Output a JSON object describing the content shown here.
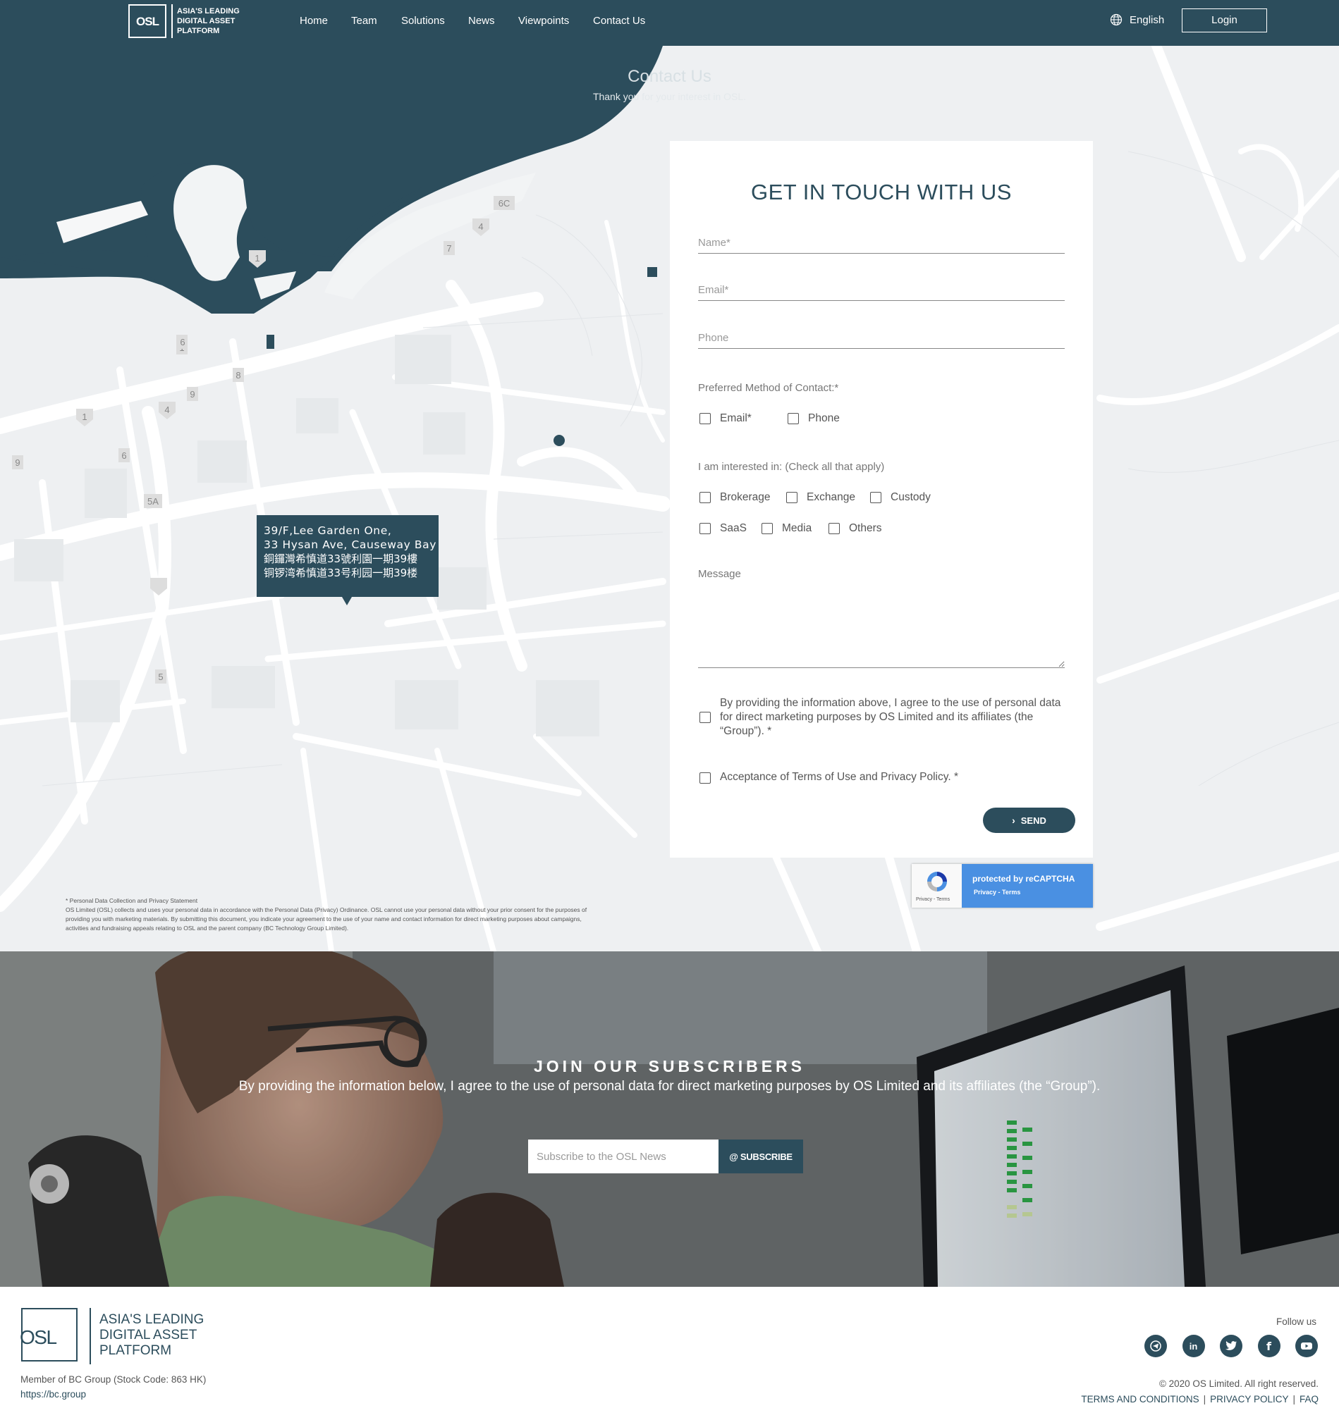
{
  "nav": {
    "logo": "OSL",
    "tagline_1": "ASIA'S LEADING",
    "tagline_2": "DIGITAL ASSET",
    "tagline_3": "PLATFORM",
    "links": [
      "Home",
      "Team",
      "Solutions",
      "News",
      "Viewpoints",
      "Contact Us"
    ],
    "language": "English",
    "login": "Login"
  },
  "hero": {
    "title": "Contact Us",
    "subtitle": "Thank you for your interest in OSL."
  },
  "map": {
    "address_1": "39/F,Lee Garden One,",
    "address_2": "33 Hysan Ave, Causeway Bay",
    "address_3": "銅鑼灣希慎道33號利園一期39樓",
    "address_4": "铜锣湾希慎道33号利园一期39楼",
    "route_labels": [
      "1",
      "6",
      "8",
      "9",
      "1",
      "4",
      "6",
      "5A",
      "9",
      "5",
      "7",
      "4",
      "6C"
    ]
  },
  "form": {
    "title": "GET IN TOUCH WITH US",
    "name_placeholder": "Name*",
    "email_placeholder": "Email*",
    "phone_placeholder": "Phone",
    "method_label": "Preferred Method of Contact:*",
    "method_email": "Email*",
    "method_phone": "Phone",
    "interest_label": "I am interested in: (Check all that apply)",
    "interest_brokerage": "Brokerage",
    "interest_exchange": "Exchange",
    "interest_custody": "Custody",
    "interest_saas": "SaaS",
    "interest_media": "Media",
    "interest_others": "Others",
    "message_placeholder": "Message",
    "consent_text": "By providing the information above, I agree to the use of personal data for direct marketing purposes by OS Limited and its affiliates (the “Group”). *",
    "accept_text": "Acceptance of Terms of Use and Privacy Policy. *",
    "send_label": "SEND"
  },
  "recaptcha": {
    "title": "protected by reCAPTCHA",
    "links": "Privacy - Terms",
    "small_links": "Privacy - Terms"
  },
  "disclaimer": {
    "heading": "* Personal Data Collection and Privacy Statement",
    "body": "OS Limited (OSL) collects and uses your personal data in accordance with the Personal Data (Privacy) Ordinance. OSL cannot use your personal data without your prior consent for the purposes of providing you with marketing materials. By submitting this document, you indicate your agreement to the use of your name and contact information for direct marketing purposes about campaigns, activities and fundraising appeals relating to OSL and the parent company (BC Technology Group Limited)."
  },
  "subscribe": {
    "title": "JOIN OUR SUBSCRIBERS",
    "text": "By providing the information below, I agree to the use of personal data for direct marketing purposes by OS Limited and its affiliates (the “Group”).",
    "input_placeholder": "Subscribe to the OSL News",
    "button": "@ SUBSCRIBE"
  },
  "footer": {
    "logo": "OSL",
    "tagline_1": "ASIA'S LEADING",
    "tagline_2": "DIGITAL ASSET",
    "tagline_3": "PLATFORM",
    "member": "Member of BC Group (Stock Code: 863 HK)",
    "url": "https://bc.group",
    "follow": "Follow us",
    "socials": [
      "telegram-icon",
      "linkedin-icon",
      "twitter-icon",
      "facebook-icon",
      "youtube-icon"
    ],
    "copyright": "© 2020 OS Limited. All right reserved.",
    "terms": "TERMS AND CONDITIONS",
    "privacy": "PRIVACY POLICY",
    "faq": "FAQ"
  },
  "colors": {
    "brand": "#2c4d5c",
    "map_land": "#eef0f2",
    "recaptcha_blue": "#4a90e2"
  }
}
